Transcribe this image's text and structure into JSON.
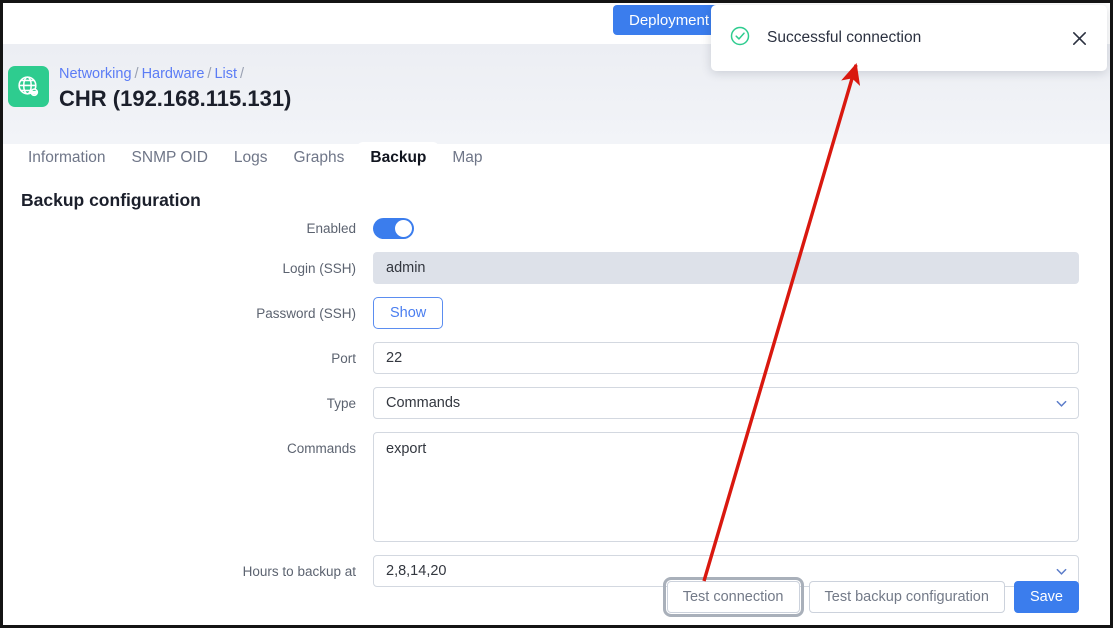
{
  "topbar": {
    "deployment_button": "Deployment"
  },
  "toast": {
    "message": "Successful connection",
    "status_icon": "check-circle-icon",
    "close_icon": "close-icon",
    "accent_color": "#2ecc8f"
  },
  "header": {
    "device_icon": "globe-network-icon",
    "icon_color": "#2ecc8f",
    "breadcrumb": [
      {
        "label": "Networking",
        "link": true
      },
      {
        "label": "Hardware",
        "link": true
      },
      {
        "label": "List",
        "link": true
      }
    ],
    "separator": "/",
    "title": "CHR (192.168.115.131)"
  },
  "tabs": [
    {
      "label": "Information",
      "active": false
    },
    {
      "label": "SNMP OID",
      "active": false
    },
    {
      "label": "Logs",
      "active": false
    },
    {
      "label": "Graphs",
      "active": false
    },
    {
      "label": "Backup",
      "active": true
    },
    {
      "label": "Map",
      "active": false
    }
  ],
  "main": {
    "section_title": "Backup configuration",
    "fields": {
      "enabled": {
        "label": "Enabled",
        "value": "on"
      },
      "login": {
        "label": "Login (SSH)",
        "value": "admin",
        "placeholder": ""
      },
      "password": {
        "label": "Password (SSH)",
        "button_label": "Show"
      },
      "port": {
        "label": "Port",
        "value": "22",
        "placeholder": ""
      },
      "type": {
        "label": "Type",
        "value": "Commands",
        "chevron_icon": "chevron-down-icon"
      },
      "commands": {
        "label": "Commands",
        "value": "export",
        "placeholder": ""
      },
      "hours": {
        "label": "Hours to backup at",
        "value": "2,8,14,20",
        "chevron_icon": "chevron-down-icon"
      }
    },
    "actions": {
      "test_connection": "Test connection",
      "test_backup_configuration": "Test backup configuration",
      "save": "Save"
    }
  },
  "annotation": {
    "arrow_color": "#d9180f"
  }
}
